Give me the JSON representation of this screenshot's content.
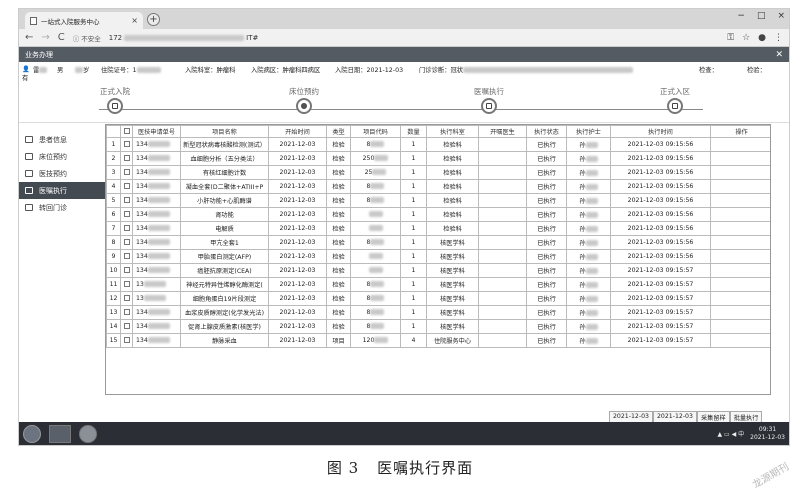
{
  "browser": {
    "tab_title": "一站式入院服务中心",
    "tab_close": "×",
    "new_tab": "+",
    "win_controls": [
      "−",
      "□",
      "×"
    ],
    "back": "←",
    "forward": "→",
    "reload": "C",
    "insecure_label": "不安全",
    "url_prefix": "172",
    "url_suffix": "IT#",
    "right_icons": [
      "⚿",
      "☆",
      "●",
      "⋮"
    ]
  },
  "app": {
    "module_title": "业务办理",
    "close": "✕"
  },
  "patient": {
    "icon": "👤",
    "name": "雷",
    "gender": "男",
    "age": "岁",
    "admission_no_label": "住院证号：1",
    "dept_label": "入院科室：肿瘤科",
    "ward_label": "入院病区：肿瘤科四病区",
    "date_label": "入院日期：2021-12-03",
    "diag_label": "门诊诊断：冠状",
    "check1": "检查：",
    "check2": "检验：",
    "cut": "有"
  },
  "steps": [
    {
      "label": "正式入院",
      "active": false
    },
    {
      "label": "床位预约",
      "active": true
    },
    {
      "label": "医嘱执行",
      "active": false
    },
    {
      "label": "正式入区",
      "active": false
    }
  ],
  "sidebar": [
    {
      "label": "患者信息",
      "active": false
    },
    {
      "label": "床位预约",
      "active": false
    },
    {
      "label": "医技预约",
      "active": false
    },
    {
      "label": "医嘱执行",
      "active": true
    },
    {
      "label": "转回门诊",
      "active": false
    }
  ],
  "table": {
    "headers": [
      "",
      "",
      "医技申请单号",
      "项目名称",
      "开始时间",
      "类型",
      "项目代码",
      "数量",
      "执行科室",
      "开嘱医生",
      "执行状态",
      "执行护士",
      "执行时间",
      "操作"
    ],
    "rows": [
      {
        "no": "1",
        "app": "134",
        "name": "新型冠状病毒核酸检测(测试）",
        "start": "2021-12-03",
        "type": "检验",
        "code": "8",
        "qty": "1",
        "dept": "检验科",
        "doctor": "",
        "status": "已执行",
        "nurse": "孙",
        "time": "2021-12-03 09:15:56"
      },
      {
        "no": "2",
        "app": "134",
        "name": "血细胞分析（五分类法）",
        "start": "2021-12-03",
        "type": "检验",
        "code": "250",
        "qty": "1",
        "dept": "检验科",
        "doctor": "",
        "status": "已执行",
        "nurse": "孙",
        "time": "2021-12-03 09:15:56"
      },
      {
        "no": "3",
        "app": "134",
        "name": "有核红细胞计数",
        "start": "2021-12-03",
        "type": "检验",
        "code": "25",
        "qty": "1",
        "dept": "检验科",
        "doctor": "",
        "status": "已执行",
        "nurse": "孙",
        "time": "2021-12-03 09:15:56"
      },
      {
        "no": "4",
        "app": "134",
        "name": "凝血全套(D二聚体+ATIII+P",
        "start": "2021-12-03",
        "type": "检验",
        "code": "8",
        "qty": "1",
        "dept": "检验科",
        "doctor": "",
        "status": "已执行",
        "nurse": "孙",
        "time": "2021-12-03 09:15:56"
      },
      {
        "no": "5",
        "app": "134",
        "name": "小肝功能+心肌酶谱",
        "start": "2021-12-03",
        "type": "检验",
        "code": "8",
        "qty": "1",
        "dept": "检验科",
        "doctor": "",
        "status": "已执行",
        "nurse": "孙",
        "time": "2021-12-03 09:15:56"
      },
      {
        "no": "6",
        "app": "134",
        "name": "肾功能",
        "start": "2021-12-03",
        "type": "检验",
        "code": "",
        "qty": "1",
        "dept": "检验科",
        "doctor": "",
        "status": "已执行",
        "nurse": "孙",
        "time": "2021-12-03 09:15:56"
      },
      {
        "no": "7",
        "app": "134",
        "name": "电解质",
        "start": "2021-12-03",
        "type": "检验",
        "code": "",
        "qty": "1",
        "dept": "检验科",
        "doctor": "",
        "status": "已执行",
        "nurse": "孙",
        "time": "2021-12-03 09:15:56"
      },
      {
        "no": "8",
        "app": "134",
        "name": "甲亢全套1",
        "start": "2021-12-03",
        "type": "检验",
        "code": "8",
        "qty": "1",
        "dept": "核医学科",
        "doctor": "",
        "status": "已执行",
        "nurse": "孙",
        "time": "2021-12-03 09:15:56"
      },
      {
        "no": "9",
        "app": "134",
        "name": "甲胎蛋白测定(AFP)",
        "start": "2021-12-03",
        "type": "检验",
        "code": "",
        "qty": "1",
        "dept": "核医学科",
        "doctor": "",
        "status": "已执行",
        "nurse": "孙",
        "time": "2021-12-03 09:15:56"
      },
      {
        "no": "10",
        "app": "134",
        "name": "癌胚抗原测定(CEA)",
        "start": "2021-12-03",
        "type": "检验",
        "code": "",
        "qty": "1",
        "dept": "核医学科",
        "doctor": "",
        "status": "已执行",
        "nurse": "孙",
        "time": "2021-12-03 09:15:57"
      },
      {
        "no": "11",
        "app": "13",
        "name": "神经元特异性烯醇化酶测定(",
        "start": "2021-12-03",
        "type": "检验",
        "code": "8",
        "qty": "1",
        "dept": "核医学科",
        "doctor": "",
        "status": "已执行",
        "nurse": "孙",
        "time": "2021-12-03 09:15:57"
      },
      {
        "no": "12",
        "app": "13",
        "name": "细胞角蛋白19片段测定",
        "start": "2021-12-03",
        "type": "检验",
        "code": "8",
        "qty": "1",
        "dept": "核医学科",
        "doctor": "",
        "status": "已执行",
        "nurse": "孙",
        "time": "2021-12-03 09:15:57"
      },
      {
        "no": "13",
        "app": "134",
        "name": "血浆皮质醇测定(化学发光法)",
        "start": "2021-12-03",
        "type": "检验",
        "code": "8",
        "qty": "1",
        "dept": "核医学科",
        "doctor": "",
        "status": "已执行",
        "nurse": "孙",
        "time": "2021-12-03 09:15:57"
      },
      {
        "no": "14",
        "app": "134",
        "name": "促肾上腺皮质激素(核医学)",
        "start": "2021-12-03",
        "type": "检验",
        "code": "8",
        "qty": "1",
        "dept": "核医学科",
        "doctor": "",
        "status": "已执行",
        "nurse": "孙",
        "time": "2021-12-03 09:15:57"
      },
      {
        "no": "15",
        "app": "134",
        "name": "静脉采血",
        "start": "2021-12-03",
        "type": "项目",
        "code": "120",
        "qty": "4",
        "dept": "住院服务中心",
        "doctor": "",
        "status": "已执行",
        "nurse": "孙",
        "time": "2021-12-03 09:15:57"
      }
    ]
  },
  "footer_buttons": [
    "2021-12-03",
    "2021-12-03",
    "采集留样",
    "批量执行"
  ],
  "taskbar": {
    "time": "09:31",
    "date": "2021-12-03",
    "tray_icons": "▲ ▭ ◀ 中"
  },
  "caption": {
    "fig": "图 3",
    "title": "医嘱执行界面"
  },
  "watermark": "龙源期刊"
}
